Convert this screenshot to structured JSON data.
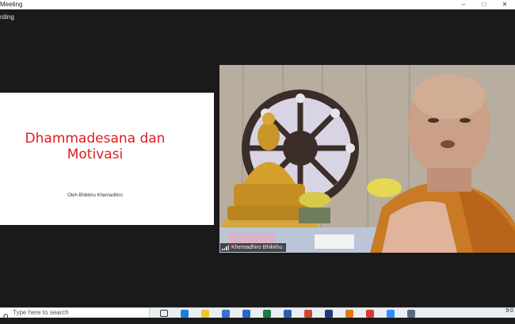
{
  "titlebar": {
    "title": "Meeting",
    "minimize": "–",
    "maximize": "□",
    "close": "✕"
  },
  "recording": {
    "label": "rding"
  },
  "slide": {
    "title_line1": "Dhammadesana dan",
    "title_line2": "Motivasi",
    "subtitle": "Oleh Bhikkhu Khemadhiro"
  },
  "video": {
    "participant_name": "Khemadhiro Bhikkhu",
    "status_icon": "signal-bars-icon"
  },
  "taskbar": {
    "search_placeholder": "Type here to search",
    "clock": "9:0",
    "icons": [
      {
        "name": "search-icon",
        "color": "#222222"
      },
      {
        "name": "task-view-icon",
        "color": "#333333"
      },
      {
        "name": "edge-icon",
        "color": "#1f7fd8"
      },
      {
        "name": "file-explorer-icon",
        "color": "#f2c230"
      },
      {
        "name": "store-icon",
        "color": "#3a6fd1"
      },
      {
        "name": "mail-icon",
        "color": "#2a66c9"
      },
      {
        "name": "excel-icon",
        "color": "#1e7a44"
      },
      {
        "name": "word-icon",
        "color": "#2b5cb6"
      },
      {
        "name": "powerpoint-icon",
        "color": "#c9482b"
      },
      {
        "name": "photoshop-icon",
        "color": "#1f3c78"
      },
      {
        "name": "illustrator-icon",
        "color": "#e07a10"
      },
      {
        "name": "chrome-icon",
        "color": "#db3a2d"
      },
      {
        "name": "zoom-icon",
        "color": "#2d8cff"
      },
      {
        "name": "app-icon",
        "color": "#5a6b7c"
      }
    ]
  }
}
